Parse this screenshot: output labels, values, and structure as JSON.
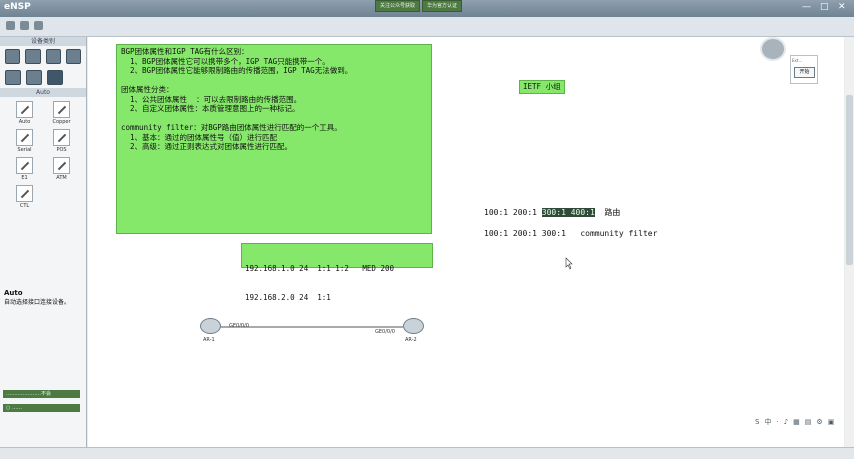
{
  "app": {
    "title": "eNSP"
  },
  "top_buttons": [
    "关注公众号获取",
    "华为官方认证"
  ],
  "window_controls": [
    "—",
    "□",
    "✕"
  ],
  "left_panel": {
    "header": "设备类别",
    "section_label": "Auto",
    "links": [
      "Auto",
      "Copper",
      "Serial",
      "POS",
      "E1",
      "ATM",
      "CTL"
    ],
    "description_title": "Auto",
    "description_text": "自动选择接口连接设备。",
    "bar1": "…………………不会",
    "bar2": "○ ……"
  },
  "notes": {
    "main": "BGP团体属性和IGP TAG有什么区别：\n  1、BGP团体属性它可以携带多个，IGP TAG只能携带一个。\n  2、BGP团体属性它能够限制路由的传播范围，IGP TAG无法做到。\n\n团体属性分类：\n  1、公共团体属性  ：可以去限制路由的传播范围。\n  2、自定义团体属性：本质管理意图上的一种标记。\n\ncommunity filter：对BGP路由团体属性进行匹配的一个工具。\n  1、基本：通过的团体属性号（值）进行匹配\n  2、高级：通过正则表达式对团体属性进行匹配。",
    "ietf": "IETF 小组",
    "routes_line1": "192.168.1.0 24  1:1 1:2   MED 200",
    "routes_line2": "192.168.2.0 24  1:1"
  },
  "community_lines": {
    "line1_prefix": "100:1 200:1 ",
    "line1_highlight": "300:1 400:1",
    "line1_suffix": "  路由",
    "line2": "100:1 200:1 300:1   community filter"
  },
  "topology": {
    "router1": "AR-1",
    "router2": "AR-2",
    "if1": "GE0/0/0",
    "if2": "GE0/0/0"
  },
  "mini_panel": {
    "label": "Ext...",
    "start_button": "开始"
  },
  "tray_icons": [
    "S",
    "中",
    "·",
    "♪",
    "▦",
    "▤",
    "⚙",
    "▣"
  ],
  "colors": {
    "note_green": "#86e86a",
    "highlight": "#2f4a3a",
    "titlebar": "#7f93a3"
  }
}
